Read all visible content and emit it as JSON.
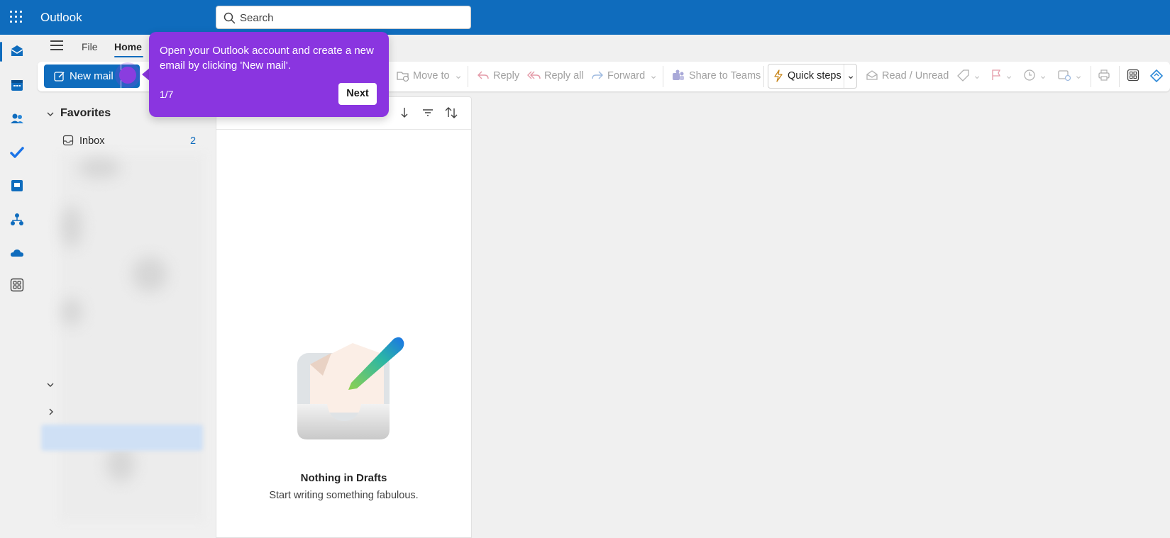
{
  "app": {
    "title": "Outlook",
    "brand_color": "#0f6cbd"
  },
  "search": {
    "placeholder": "Search"
  },
  "rail": {
    "items": [
      {
        "name": "mail-icon",
        "active": true
      },
      {
        "name": "calendar-icon"
      },
      {
        "name": "people-icon"
      },
      {
        "name": "todo-icon"
      },
      {
        "name": "files-icon"
      },
      {
        "name": "org-icon"
      },
      {
        "name": "onedrive-icon"
      },
      {
        "name": "apps-icon"
      }
    ]
  },
  "ribbon": {
    "tabs": {
      "file": "File",
      "home": "Home"
    },
    "new_mail": "New mail",
    "move_to": "Move to",
    "reply": "Reply",
    "reply_all": "Reply all",
    "forward": "Forward",
    "share_to_teams": "Share to Teams",
    "quick_steps": "Quick steps",
    "read_unread": "Read / Unread"
  },
  "folders": {
    "favorites_title": "Favorites",
    "inbox_label": "Inbox",
    "inbox_count": "2"
  },
  "message_list": {
    "empty_title": "Nothing in Drafts",
    "empty_subtitle": "Start writing something fabulous."
  },
  "tour": {
    "text": "Open your Outlook account and create a new email by clicking 'New mail'.",
    "step": "1/7",
    "next_label": "Next",
    "color": "#8a35e0"
  }
}
